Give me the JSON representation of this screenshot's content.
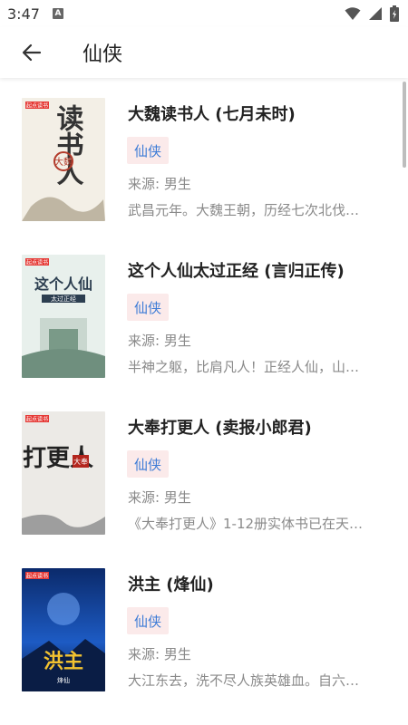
{
  "status_bar": {
    "time": "3:47",
    "notification_icon_letter": "A",
    "icons": [
      "wifi-icon",
      "signal-icon",
      "battery-icon"
    ]
  },
  "app_bar": {
    "back_icon": "arrow-left-icon",
    "title": "仙侠"
  },
  "books": [
    {
      "title": "大魏读书人 (七月未时)",
      "tag": "仙侠",
      "source": "来源: 男生",
      "intro": "武昌元年。大魏王朝，历经七次北伐…",
      "cover": {
        "badge": "起点读书",
        "big_text": "读书人",
        "sub_text": "大魏",
        "colors": [
          "#f3efe6",
          "#b23a2a",
          "#333333"
        ]
      }
    },
    {
      "title": "这个人仙太过正经 (言归正传)",
      "tag": "仙侠",
      "source": "来源: 男生",
      "intro": "半神之躯，比肩凡人！正经人仙，山…",
      "cover": {
        "badge": "起点读书",
        "big_text": "这个人仙",
        "sub_text": "太过正经",
        "colors": [
          "#e8f0ec",
          "#2c3e50",
          "#7a9a88"
        ]
      }
    },
    {
      "title": "大奉打更人 (卖报小郎君)",
      "tag": "仙侠",
      "source": "来源: 男生",
      "intro": "《大奉打更人》1-12册实体书已在天…",
      "cover": {
        "badge": "起点读书",
        "big_text": "打更人",
        "sub_text": "大奉",
        "colors": [
          "#eceae6",
          "#222222",
          "#b3261e"
        ]
      }
    },
    {
      "title": "洪主 (烽仙)",
      "tag": "仙侠",
      "source": "来源: 男生",
      "intro": "大江东去，洗不尽人族英雄血。自六…",
      "cover": {
        "badge": "起点读书",
        "big_text": "洪主",
        "sub_text": "烽仙",
        "colors": [
          "#0b2a6b",
          "#f2c230",
          "#7ab0ff"
        ]
      }
    }
  ]
}
